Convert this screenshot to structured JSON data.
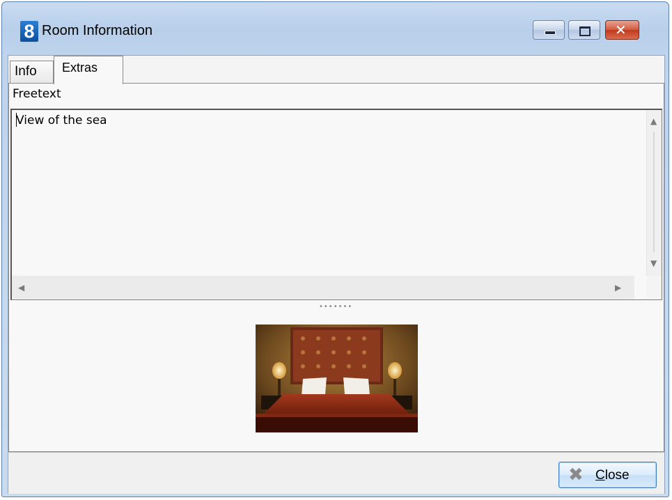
{
  "window": {
    "title": "Room Information",
    "app_icon_text": "8"
  },
  "tabs": [
    {
      "label": "Info",
      "active": false
    },
    {
      "label": "Extras",
      "active": true
    }
  ],
  "extras": {
    "freetext_label": "Freetext",
    "freetext_value": "View of the sea"
  },
  "image": {
    "subject": "hotel bedroom photo"
  },
  "footer": {
    "close_mnemonic": "C",
    "close_rest": "lose"
  },
  "icons": {
    "minimize": "minimize-icon",
    "maximize": "maximize-icon",
    "close_window": "close-icon",
    "close_button": "close-x-icon"
  },
  "colors": {
    "window_frame": "#5d7ea8",
    "close_caption": "#c2381b",
    "app_icon": "#0d4f9e",
    "button_border": "#3a7bbf"
  }
}
